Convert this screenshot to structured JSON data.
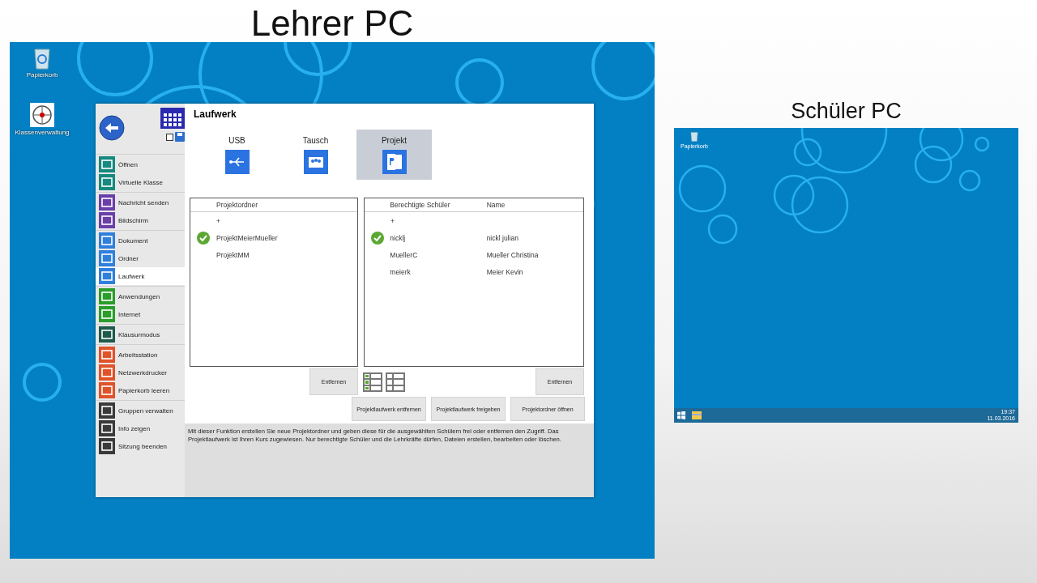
{
  "teacher": {
    "title": "Lehrer PC",
    "desktop_icons": [
      {
        "label": "Papierkorb",
        "kind": "bin"
      },
      {
        "label": "Klassenverwaltung",
        "kind": "app"
      }
    ],
    "window": {
      "save_checkbox": {
        "checked": false
      },
      "sidebar": {
        "groups": [
          {
            "color": "#17897e",
            "items": [
              {
                "label": "Öffnen",
                "selected": false
              },
              {
                "label": "Virtuelle Klasse",
                "selected": false
              }
            ]
          },
          {
            "color": "#6b3fa8",
            "items": [
              {
                "label": "Nachricht senden",
                "selected": false
              },
              {
                "label": "Bildschirm",
                "selected": false
              }
            ]
          },
          {
            "color": "#2f7fdc",
            "items": [
              {
                "label": "Dokument",
                "selected": false
              },
              {
                "label": "Ordner",
                "selected": false
              },
              {
                "label": "Laufwerk",
                "selected": true
              }
            ]
          },
          {
            "color": "#2a9d2a",
            "items": [
              {
                "label": "Anwendungen",
                "selected": false
              },
              {
                "label": "Internet",
                "selected": false
              }
            ]
          },
          {
            "color": "#1e5a4c",
            "items": [
              {
                "label": "Klausurmodus",
                "selected": false
              }
            ]
          },
          {
            "color": "#e0532a",
            "items": [
              {
                "label": "Arbeitsstation",
                "selected": false
              },
              {
                "label": "Netzwerkdrucker",
                "selected": false
              },
              {
                "label": "Papierkorb leeren",
                "selected": false
              }
            ]
          },
          {
            "color": "#3a3a3a",
            "items": [
              {
                "label": "Gruppen verwalten",
                "selected": false
              },
              {
                "label": "Info zeigen",
                "selected": false
              },
              {
                "label": "Sitzung beenden",
                "selected": false
              }
            ]
          }
        ]
      },
      "heading": "Laufwerk",
      "tabs": [
        {
          "label": "USB",
          "kind": "usb",
          "selected": false
        },
        {
          "label": "Tausch",
          "kind": "share",
          "selected": false
        },
        {
          "label": "Projekt",
          "kind": "project",
          "selected": true
        }
      ],
      "folders": {
        "columns": [
          "Projektordner"
        ],
        "add_row": "+",
        "rows": [
          {
            "cells": [
              "ProjektMeierMueller"
            ],
            "checked": true
          },
          {
            "cells": [
              "ProjektMM"
            ],
            "checked": false
          }
        ],
        "remove_button": "Entfernen"
      },
      "view_buttons": [
        {
          "kind": "checklist"
        },
        {
          "kind": "list"
        }
      ],
      "students": {
        "columns": [
          "Berechtigte Schüler",
          "Name"
        ],
        "add_row": "+",
        "rows": [
          {
            "cells": [
              "nicklj",
              "nickl julian"
            ],
            "checked": true
          },
          {
            "cells": [
              "MuellerC",
              "Mueller Christina"
            ],
            "checked": false
          },
          {
            "cells": [
              "meierk",
              "Meier Kevin"
            ],
            "checked": false
          }
        ],
        "remove_button": "Entfernen"
      },
      "actions": [
        "Projektlaufwerk entfernen",
        "Projektlaufwerk freigeben",
        "Projektordner öffnen"
      ],
      "info": "Mit dieser Funktion erstellen Sie neue Projektordner und geben diese für die ausgewählten Schülern frei oder entfernen den Zugriff. Das Projektlaufwerk ist Ihren Kurs zugewiesen. Nur berechtigte Schüler und die Lehrkräfte dürfen, Dateien erstellen, bearbeiten oder löschen."
    }
  },
  "student": {
    "title": "Schüler PC",
    "desktop_icons": [
      {
        "label": "Papierkorb",
        "kind": "bin"
      }
    ],
    "taskbar": {
      "time": "19:37",
      "date": "11.03.2016"
    }
  }
}
